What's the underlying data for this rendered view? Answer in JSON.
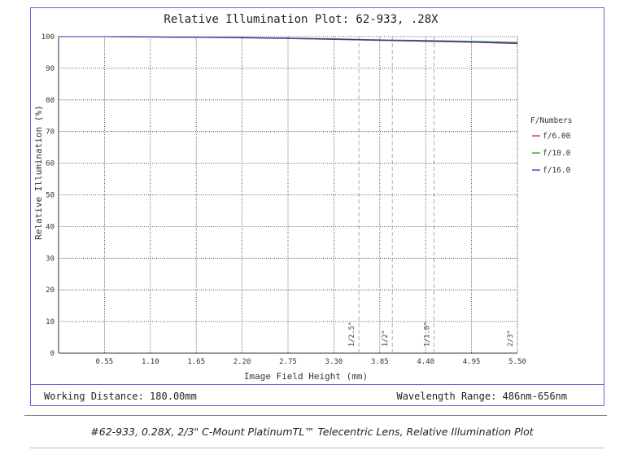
{
  "chart_data": {
    "type": "line",
    "title": "Relative Illumination Plot: 62-933, .28X",
    "xlabel": "Image Field Height (mm)",
    "ylabel": "Relative Illumination (%)",
    "xlim": [
      0,
      5.5
    ],
    "ylim": [
      0,
      100
    ],
    "x_ticks": [
      "0.55",
      "1.10",
      "1.65",
      "2.20",
      "2.75",
      "3.30",
      "3.85",
      "4.40",
      "4.95",
      "5.50"
    ],
    "y_ticks": [
      "0",
      "10",
      "20",
      "30",
      "40",
      "50",
      "60",
      "70",
      "80",
      "90",
      "100"
    ],
    "grid": true,
    "legend_title": "F/Numbers",
    "legend_position": "right",
    "x": [
      0,
      0.55,
      1.1,
      1.65,
      2.2,
      2.75,
      3.3,
      3.85,
      4.4,
      4.95,
      5.5
    ],
    "series": [
      {
        "name": "f/6.00",
        "color": "#d03030",
        "values": [
          100,
          100,
          99.9,
          99.8,
          99.6,
          99.4,
          99.1,
          98.8,
          98.5,
          98.2,
          97.8
        ]
      },
      {
        "name": "f/10.0",
        "color": "#2e9a2e",
        "values": [
          100,
          100,
          99.9,
          99.8,
          99.7,
          99.5,
          99.3,
          99.0,
          98.8,
          98.5,
          98.2
        ]
      },
      {
        "name": "f/16.0",
        "color": "#3030c0",
        "values": [
          100,
          100,
          99.9,
          99.8,
          99.7,
          99.5,
          99.2,
          98.9,
          98.6,
          98.3,
          97.9
        ]
      }
    ],
    "annotations": [
      {
        "label": "1/2.5\"",
        "x": 3.6
      },
      {
        "label": "1/2\"",
        "x": 4.0
      },
      {
        "label": "1/1.8\"",
        "x": 4.5
      },
      {
        "label": "2/3\"",
        "x": 5.5
      }
    ]
  },
  "info": {
    "working_distance": "Working Distance: 180.00mm",
    "wavelength_range": "Wavelength Range: 486nm-656nm"
  },
  "caption": "#62-933, 0.28X, 2/3\" C-Mount PlatinumTL™ Telecentric Lens, Relative Illumination Plot"
}
